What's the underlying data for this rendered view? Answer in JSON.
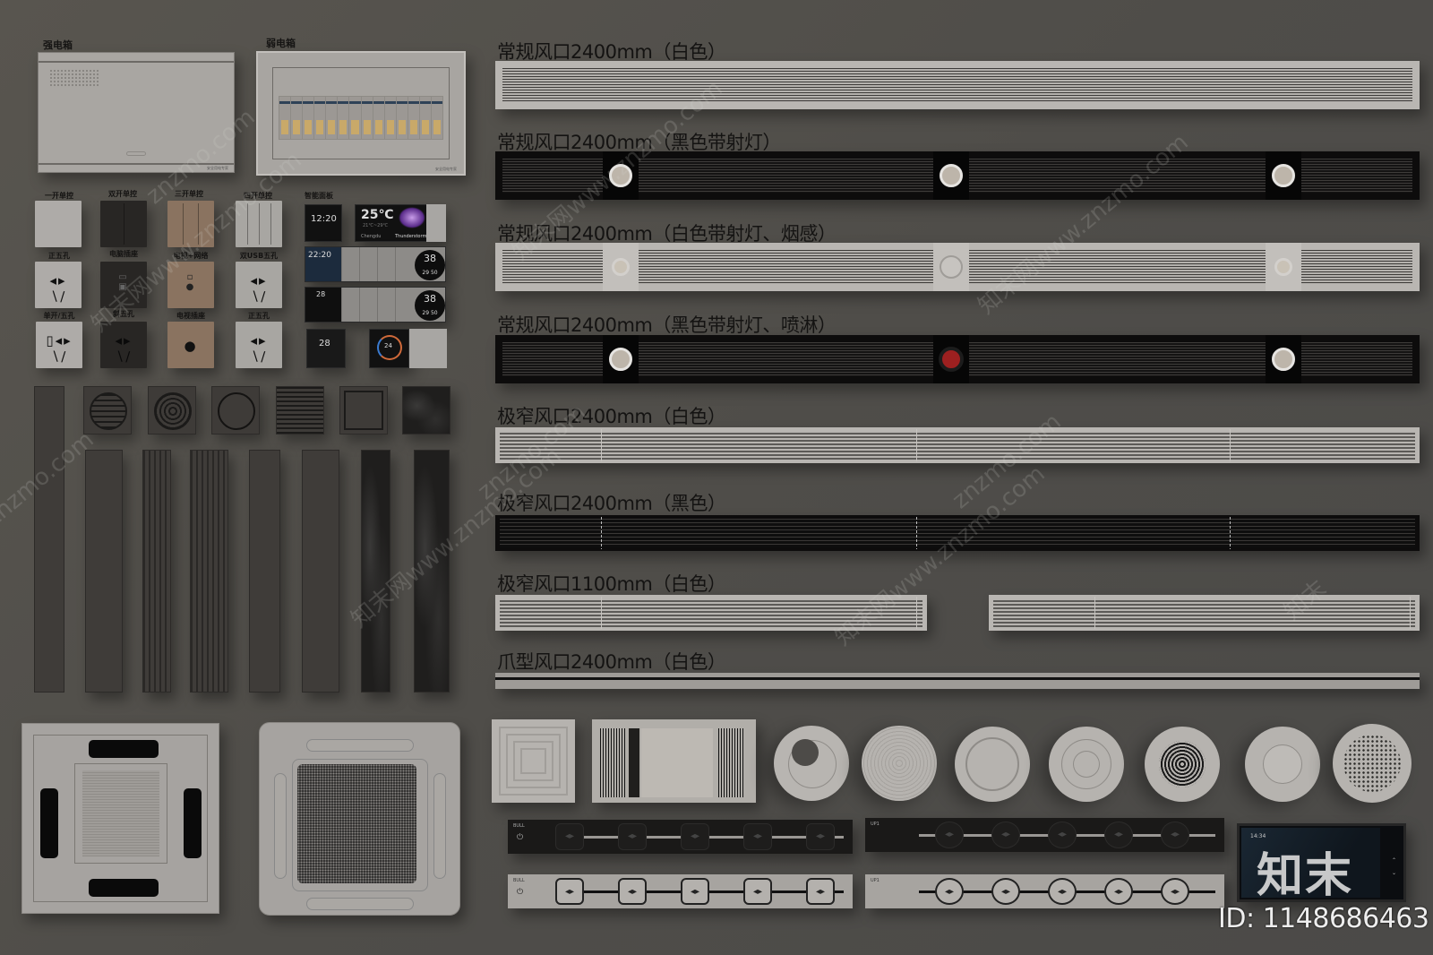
{
  "panels": {
    "strong_box": {
      "label": "强电箱",
      "tag": "安全用电专家"
    },
    "weak_box": {
      "label": "弱电箱",
      "tag": "安全用电专家",
      "breaker_count": 14
    }
  },
  "switches": {
    "row1": [
      "一开单控",
      "双开单控",
      "三开单控",
      "四开单控"
    ],
    "row2": [
      "正五孔",
      "电脑插座",
      "电视+网络",
      "双USB五孔"
    ],
    "row3": [
      "单开/五孔",
      "斜五孔",
      "电视插座",
      "正五孔"
    ],
    "smart_label": "智能面板"
  },
  "smart_panels": {
    "clock": "12:20",
    "weather_temp": "25℃",
    "weather_range": "21℃~29℃",
    "weather_city": "Chengdu",
    "weather_desc": "Thunderstorm",
    "home_time": "22:20",
    "dial_value": "38",
    "dial_sub": "29 50",
    "dial2_value": "38",
    "dial2_sub": "29 50",
    "thermo_a": "28",
    "thermo_b": "28",
    "thermo_ring": "24"
  },
  "vents": [
    {
      "label": "常规风口2400mm（白色）",
      "style": "white",
      "lamps": 0
    },
    {
      "label": "常规风口2400mm（黑色带射灯）",
      "style": "black",
      "lamps": 3
    },
    {
      "label": "常规风口2400mm（白色带射灯、烟感）",
      "style": "white",
      "lamps": 3
    },
    {
      "label": "常规风口2400mm（黑色带射灯、喷淋）",
      "style": "black",
      "lamps": 3
    },
    {
      "label": "极窄风口2400mm（白色）",
      "style": "narrow-white"
    },
    {
      "label": "极窄风口2400mm（黑色）",
      "style": "narrow-black"
    },
    {
      "label": "极窄风口1100mm（白色）",
      "style": "narrow-white-short"
    },
    {
      "label": "爪型风口2400mm（白色）",
      "style": "claw"
    }
  ],
  "tracks": {
    "brand": "BULL",
    "model": "UP1",
    "outlets_per_track": 5
  },
  "tablet": {
    "time": "14:34"
  },
  "watermarks": {
    "logo": "知末",
    "site": "znzmo.com",
    "site_long": "知末网www.znzmo.com",
    "id": "ID: 1148686463"
  }
}
